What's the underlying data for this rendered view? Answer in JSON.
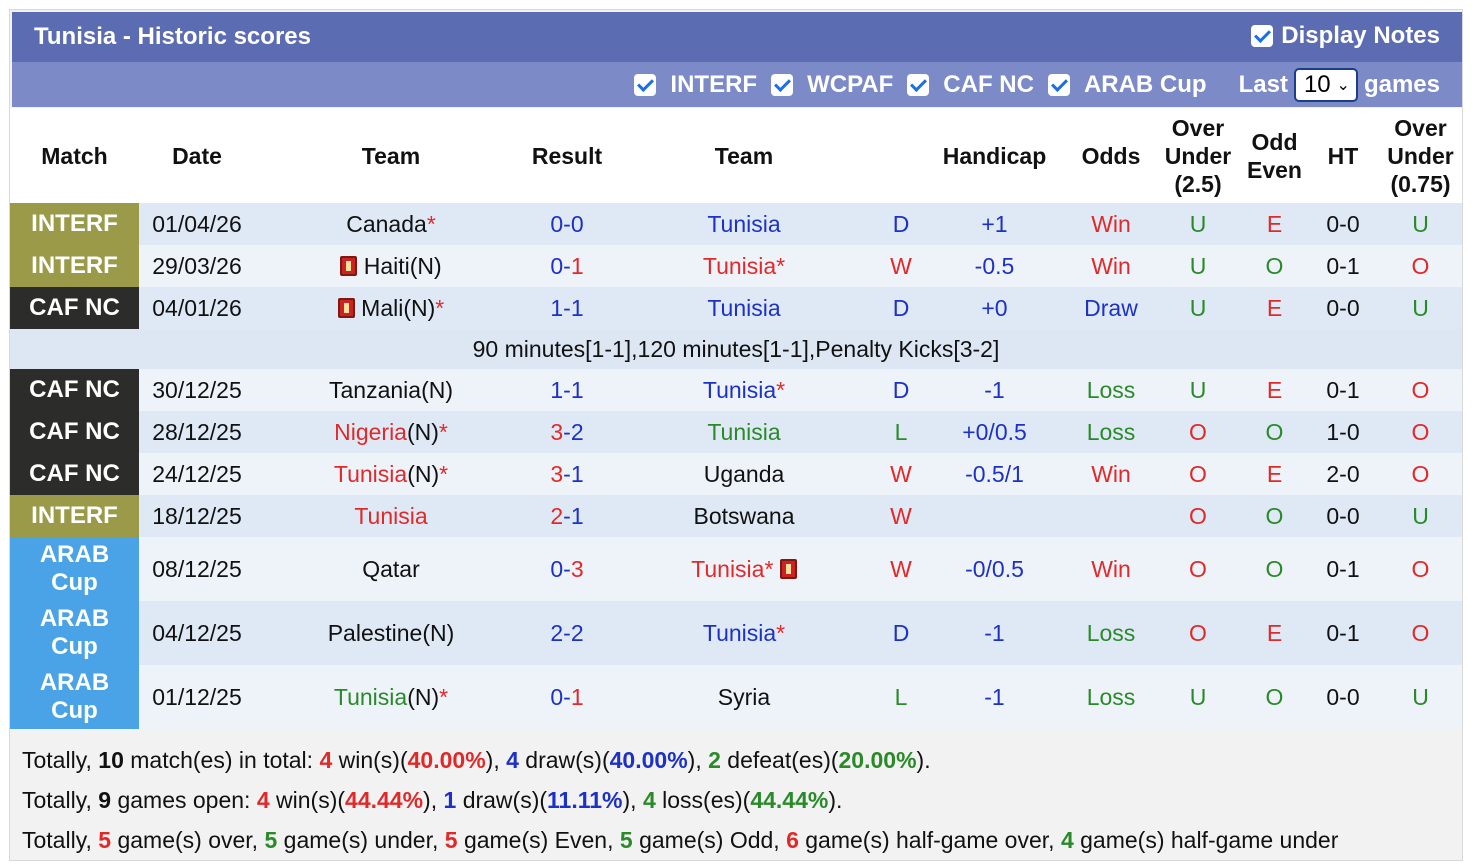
{
  "header": {
    "title": "Tunisia - Historic scores",
    "display_notes": "Display Notes",
    "filters": [
      "INTERF",
      "WCPAF",
      "CAF NC",
      "ARAB Cup"
    ],
    "last_label": "Last",
    "last_value": "10",
    "games_label": "games"
  },
  "columns": {
    "match": "Match",
    "date": "Date",
    "team_home": "Team",
    "result": "Result",
    "team_away": "Team",
    "handicap": "Handicap",
    "odds": "Odds",
    "ou25_1": "Over",
    "ou25_2": "Under",
    "ou25_3": "(2.5)",
    "oe_1": "Odd",
    "oe_2": "Even",
    "ht": "HT",
    "ou075_1": "Over",
    "ou075_2": "Under",
    "ou075_3": "(0.75)"
  },
  "rows": [
    {
      "league": "INTERF",
      "date": "01/04/26",
      "home": "Canada",
      "home_star": "*",
      "home_n": "",
      "score_home": "0",
      "score_away": "0",
      "away": "Tunisia",
      "away_star": "",
      "outcome": "D",
      "handicap": "+1",
      "odds": "Win",
      "ou25": "U",
      "oe": "E",
      "ht": "0-0",
      "ou075": "U"
    },
    {
      "league": "INTERF",
      "date": "29/03/26",
      "home": "Haiti",
      "home_star": "",
      "home_n": "(N)",
      "score_home": "0",
      "score_away": "1",
      "away": "Tunisia",
      "away_star": "*",
      "outcome": "W",
      "handicap": "-0.5",
      "odds": "Win",
      "ou25": "U",
      "oe": "O",
      "ht": "0-1",
      "ou075": "O"
    },
    {
      "league": "CAF NC",
      "date": "04/01/26",
      "home": "Mali",
      "home_star": "*",
      "home_n": "(N)",
      "score_home": "1",
      "score_away": "1",
      "away": "Tunisia",
      "away_star": "",
      "outcome": "D",
      "handicap": "+0",
      "odds": "Draw",
      "ou25": "U",
      "oe": "E",
      "ht": "0-0",
      "ou075": "U"
    },
    {
      "note": "90 minutes[1-1],120 minutes[1-1],Penalty Kicks[3-2]"
    },
    {
      "league": "CAF NC",
      "date": "30/12/25",
      "home": "Tanzania",
      "home_star": "",
      "home_n": "(N)",
      "score_home": "1",
      "score_away": "1",
      "away": "Tunisia",
      "away_star": "*",
      "outcome": "D",
      "handicap": "-1",
      "odds": "Loss",
      "ou25": "U",
      "oe": "E",
      "ht": "0-1",
      "ou075": "O"
    },
    {
      "league": "CAF NC",
      "date": "28/12/25",
      "home": "Nigeria",
      "home_star": "*",
      "home_n": "(N)",
      "score_home": "3",
      "score_away": "2",
      "away": "Tunisia",
      "away_star": "",
      "outcome": "L",
      "handicap": "+0/0.5",
      "odds": "Loss",
      "ou25": "O",
      "oe": "O",
      "ht": "1-0",
      "ou075": "O"
    },
    {
      "league": "CAF NC",
      "date": "24/12/25",
      "home": "Tunisia",
      "home_star": "*",
      "home_n": "(N)",
      "score_home": "3",
      "score_away": "1",
      "away": "Uganda",
      "away_star": "",
      "outcome": "W",
      "handicap": "-0.5/1",
      "odds": "Win",
      "ou25": "O",
      "oe": "E",
      "ht": "2-0",
      "ou075": "O"
    },
    {
      "league": "INTERF",
      "date": "18/12/25",
      "home": "Tunisia",
      "home_star": "",
      "home_n": "",
      "score_home": "2",
      "score_away": "1",
      "away": "Botswana",
      "away_star": "",
      "outcome": "W",
      "handicap": "",
      "odds": "",
      "ou25": "O",
      "oe": "O",
      "ht": "0-0",
      "ou075": "U"
    },
    {
      "league": "ARAB Cup",
      "date": "08/12/25",
      "home": "Qatar",
      "home_star": "",
      "home_n": "",
      "score_home": "0",
      "score_away": "3",
      "away": "Tunisia",
      "away_star": "*",
      "outcome": "W",
      "handicap": "-0/0.5",
      "odds": "Win",
      "ou25": "O",
      "oe": "O",
      "ht": "0-1",
      "ou075": "O"
    },
    {
      "league": "ARAB Cup",
      "date": "04/12/25",
      "home": "Palestine",
      "home_star": "",
      "home_n": "(N)",
      "score_home": "2",
      "score_away": "2",
      "away": "Tunisia",
      "away_star": "*",
      "outcome": "D",
      "handicap": "-1",
      "odds": "Loss",
      "ou25": "O",
      "oe": "E",
      "ht": "0-1",
      "ou075": "O"
    },
    {
      "league": "ARAB Cup",
      "date": "01/12/25",
      "home": "Tunisia",
      "home_star": "*",
      "home_n": "(N)",
      "score_home": "0",
      "score_away": "1",
      "away": "Syria",
      "away_star": "",
      "outcome": "L",
      "handicap": "-1",
      "odds": "Loss",
      "ou25": "U",
      "oe": "O",
      "ht": "0-0",
      "ou075": "U"
    }
  ],
  "summary": {
    "l1_a": "Totally,",
    "l1_total": "10",
    "l1_b": "match(es) in total:",
    "l1_wins": "4",
    "l1_c": "win(s)(",
    "l1_win_pct": "40.00%",
    "l1_d": "),",
    "l1_draws": "4",
    "l1_e": "draw(s)(",
    "l1_draw_pct": "40.00%",
    "l1_f": "),",
    "l1_defeats": "2",
    "l1_g": "defeat(es)(",
    "l1_def_pct": "20.00%",
    "l1_h": ").",
    "l2_a": "Totally,",
    "l2_total": "9",
    "l2_b": "games open:",
    "l2_wins": "4",
    "l2_c": "win(s)(",
    "l2_win_pct": "44.44%",
    "l2_d": "),",
    "l2_draws": "1",
    "l2_e": "draw(s)(",
    "l2_draw_pct": "11.11%",
    "l2_f": "),",
    "l2_losses": "4",
    "l2_g": "loss(es)(",
    "l2_loss_pct": "44.44%",
    "l2_h": ").",
    "l3_a": "Totally,",
    "l3_over": "5",
    "l3_b": "game(s) over,",
    "l3_under": "5",
    "l3_c": "game(s) under,",
    "l3_even": "5",
    "l3_d": "game(s) Even,",
    "l3_odd": "5",
    "l3_e": "game(s) Odd,",
    "l3_hover": "6",
    "l3_f": "game(s) half-game over,",
    "l3_hunder": "4",
    "l3_g": "game(s) half-game under"
  }
}
